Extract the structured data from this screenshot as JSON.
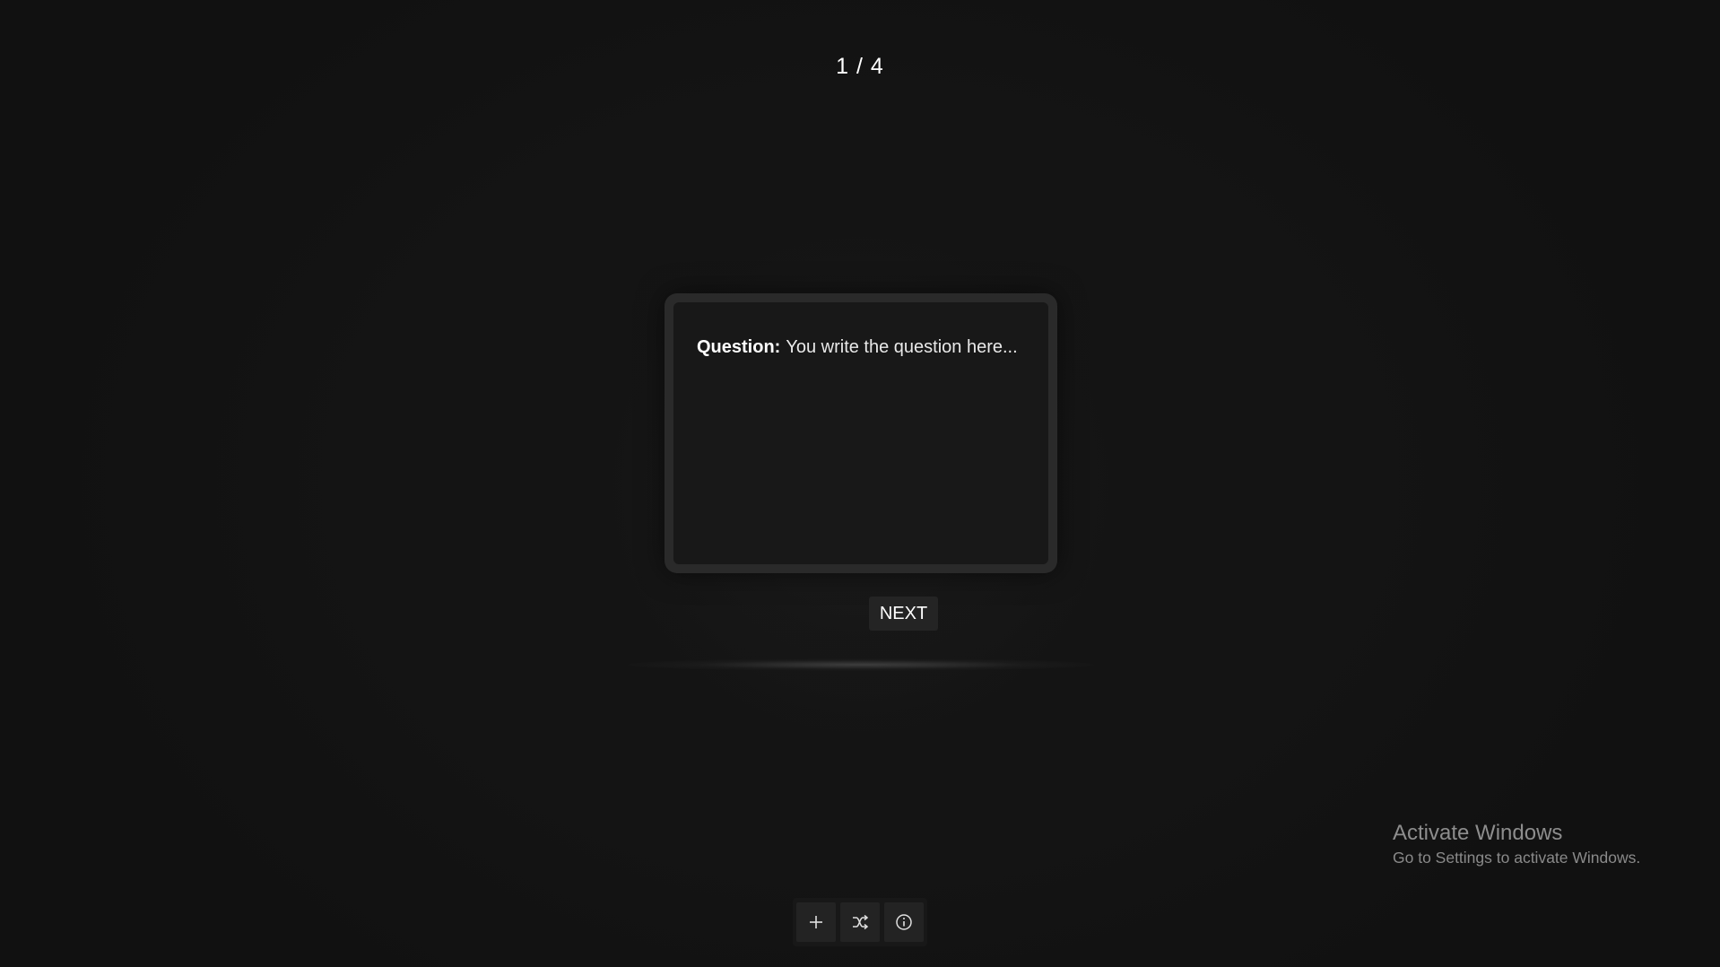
{
  "quiz": {
    "counter": "1 / 4",
    "card": {
      "label": "Question:",
      "text": "You write the question here..."
    },
    "next_label": "NEXT"
  },
  "toolbar": {
    "buttons": [
      {
        "icon": "plus-icon"
      },
      {
        "icon": "shuffle-icon"
      },
      {
        "icon": "info-icon"
      }
    ]
  },
  "watermark": {
    "title": "Activate Windows",
    "subtitle": "Go to Settings to activate Windows."
  },
  "colors": {
    "background": "#131313",
    "card_border": "#2a2a2a",
    "card_fill": "#181818",
    "button_fill": "#242424",
    "text": "#ffffff"
  }
}
